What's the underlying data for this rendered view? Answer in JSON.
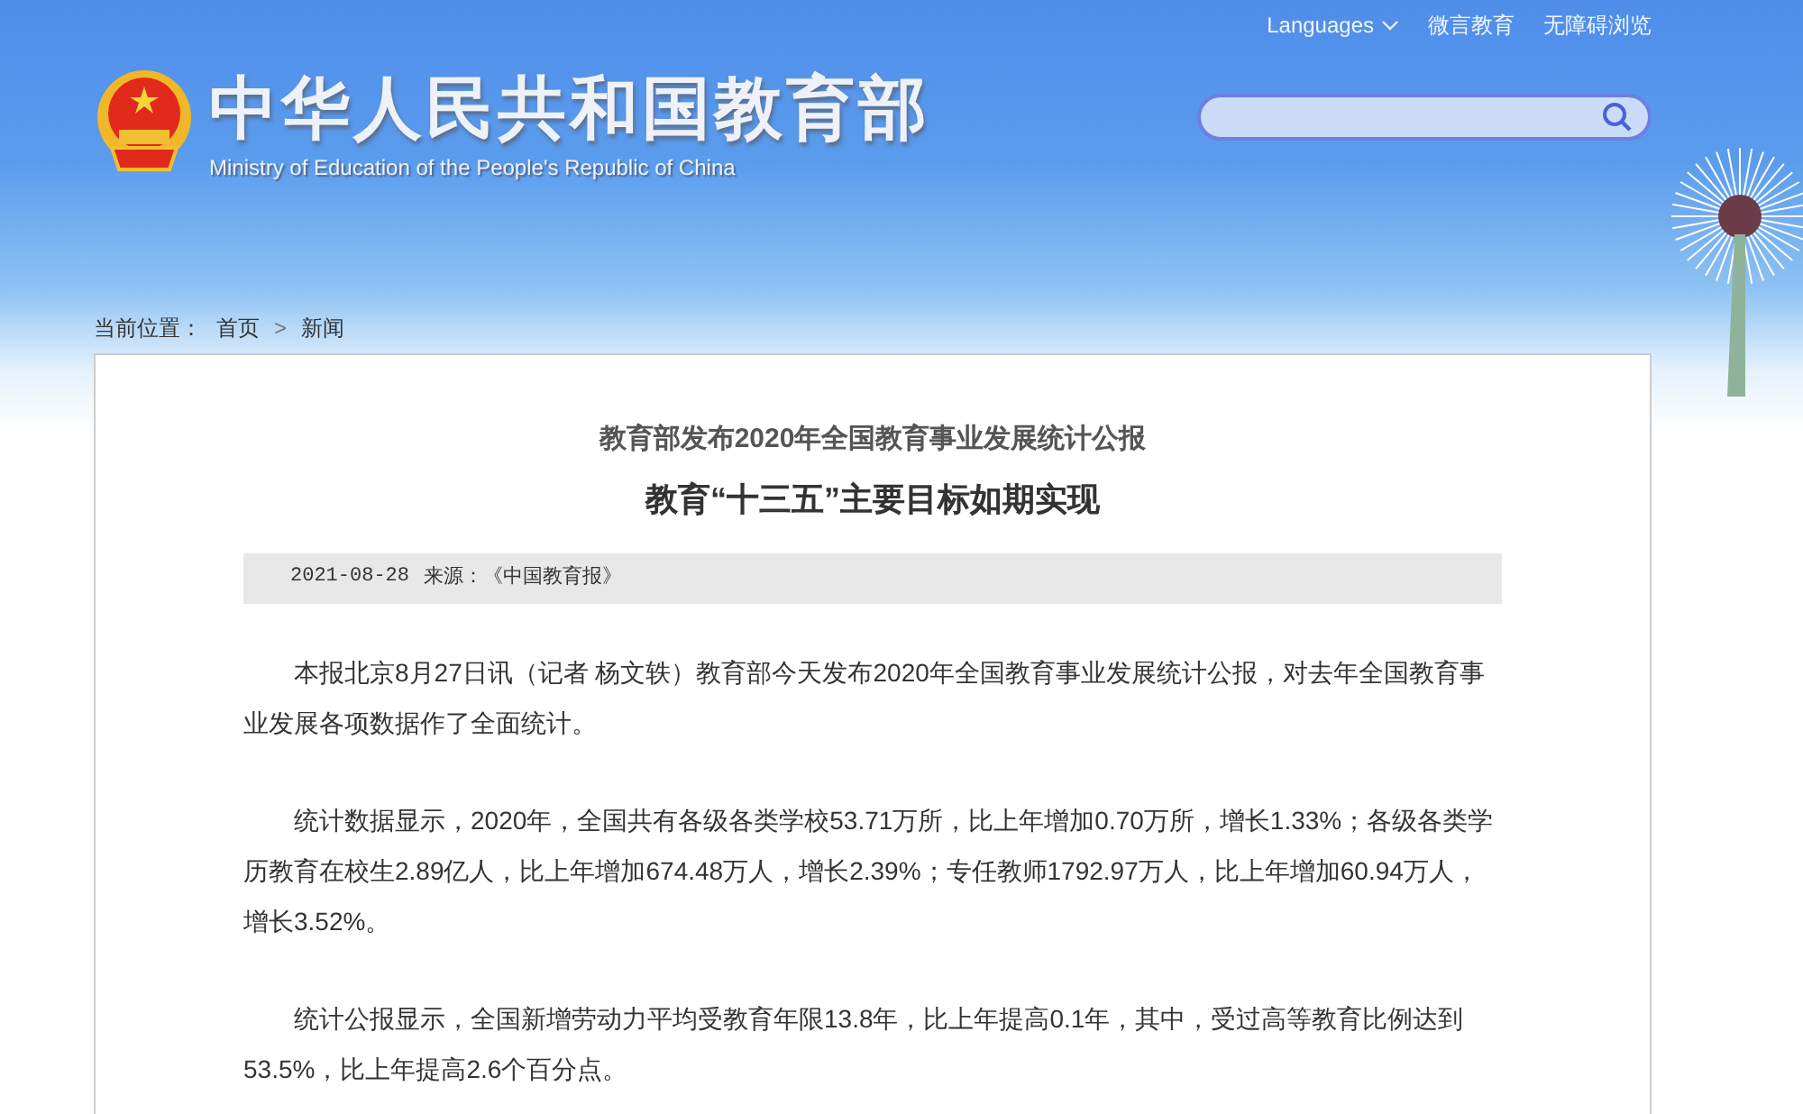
{
  "top_links": [
    {
      "label": "Languages",
      "kind": "dropdown"
    },
    {
      "label": "微言教育",
      "kind": "link"
    },
    {
      "label": "无障碍浏览",
      "kind": "link"
    }
  ],
  "logo": {
    "title": "中华人民共和国教育部",
    "subtitle": "Ministry of Education of the People's Republic of China"
  },
  "breadcrumb": {
    "label": "当前位置：",
    "items": [
      "首页",
      "新闻"
    ],
    "separator": ">"
  },
  "article": {
    "kicker": "教育部发布2020年全国教育事业发展统计公报",
    "title": "教育“十三五”主要目标如期实现",
    "date": "2021-08-28",
    "source": "来源：《中国教育报》",
    "paragraphs": [
      "本报北京8月27日讯（记者 杨文轶）教育部今天发布2020年全国教育事业发展统计公报，对去年全国教育事业发展各项数据作了全面统计。",
      "统计数据显示，2020年，全国共有各级各类学校53.71万所，比上年增加0.70万所，增长1.33%；各级各类学历教育在校生2.89亿人，比上年增加674.48万人，增长2.39%；专任教师1792.97万人，比上年增加60.94万人，增长3.52%。",
      "统计公报显示，全国新增劳动力平均受教育年限13.8年，比上年提高0.1年，其中，受过高等教育比例达到53.5%，比上年提高2.6个百分点。"
    ]
  }
}
